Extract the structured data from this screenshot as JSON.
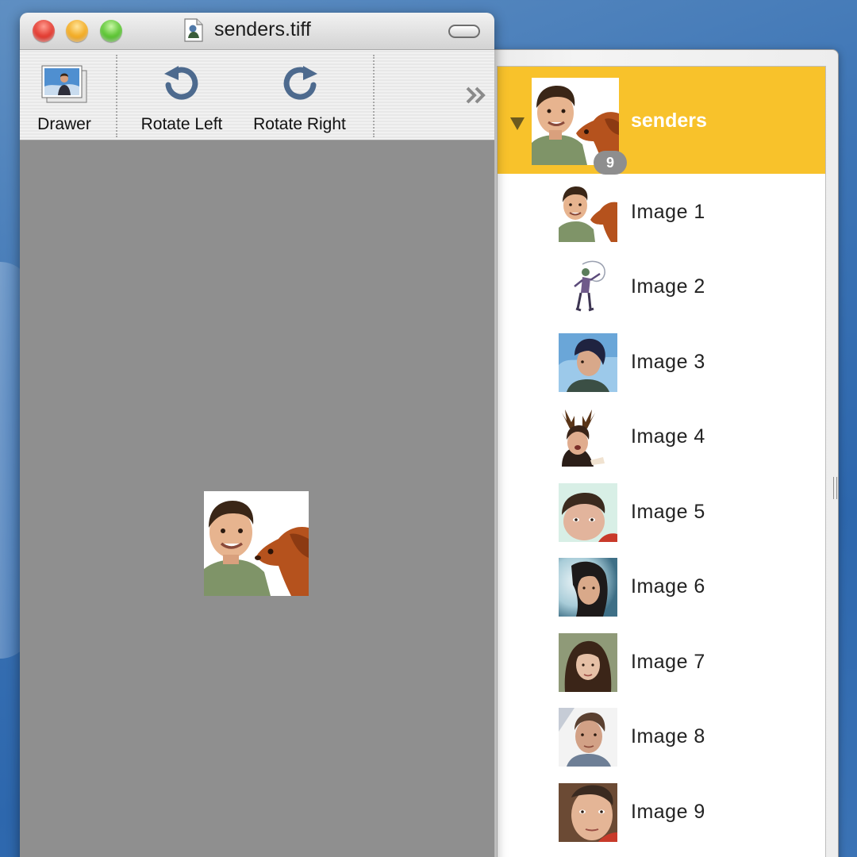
{
  "window": {
    "title": "senders.tiff",
    "title_icon": "tiff-document-icon",
    "controls": [
      "close-button",
      "minimize-button",
      "zoom-button"
    ]
  },
  "toolbar": {
    "items": [
      {
        "label": "Drawer",
        "icon": "photo-drawer-icon"
      },
      {
        "label": "Rotate Left",
        "icon": "rotate-left-icon"
      },
      {
        "label": "Rotate Right",
        "icon": "rotate-right-icon"
      }
    ],
    "overflow_icon": "chevron-double-right-icon"
  },
  "preview": {
    "image": "man-and-dog-photo"
  },
  "drawer": {
    "group": {
      "label": "senders",
      "count": "9",
      "selected_color": "#F8C22B"
    },
    "items": [
      {
        "label": "Image 1"
      },
      {
        "label": "Image 2"
      },
      {
        "label": "Image 3"
      },
      {
        "label": "Image 4"
      },
      {
        "label": "Image 5"
      },
      {
        "label": "Image 6"
      },
      {
        "label": "Image 7"
      },
      {
        "label": "Image 8"
      },
      {
        "label": "Image 9"
      }
    ]
  }
}
